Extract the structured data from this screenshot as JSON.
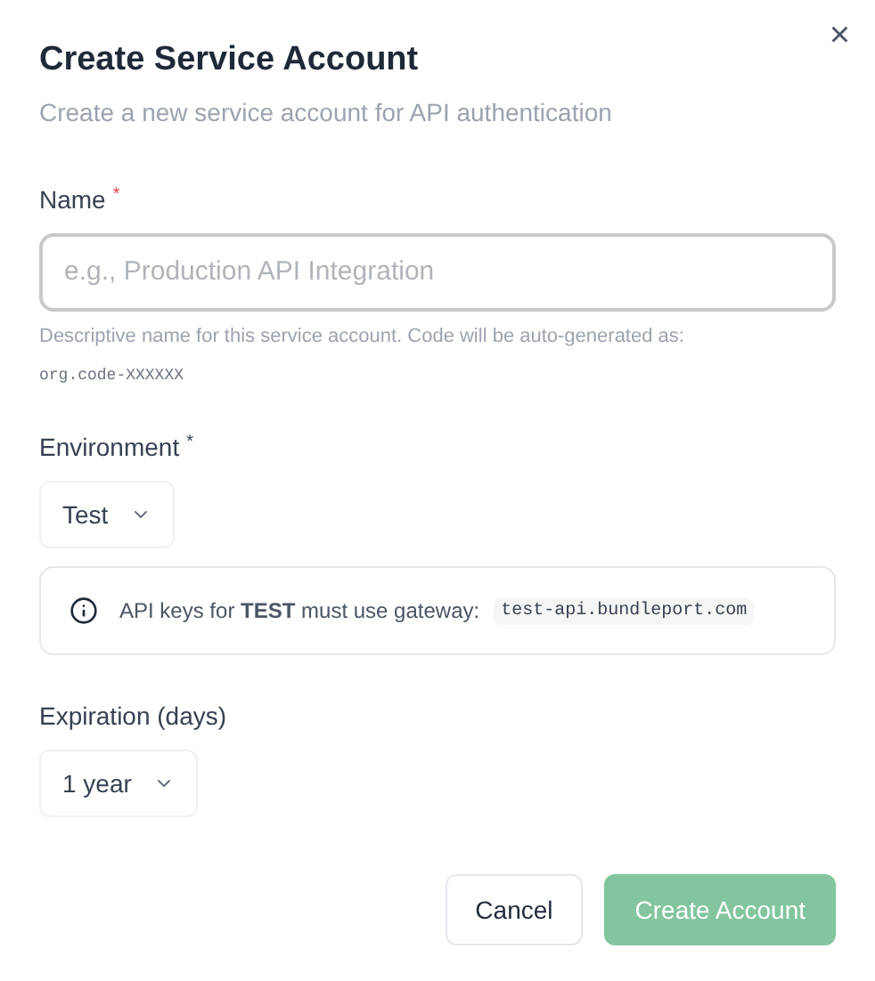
{
  "dialog": {
    "title": "Create Service Account",
    "subtitle": "Create a new service account for API authentication",
    "close": "×"
  },
  "name_field": {
    "label": "Name",
    "required_mark": "*",
    "color": "#ef4444",
    "placeholder": "e.g., Production API Integration",
    "help": "Descriptive name for this service account. Code will be auto-generated as:",
    "help_code": "org.code-XXXXXX"
  },
  "environment": {
    "label": "Environment",
    "required_mark": "*",
    "color": "#374151",
    "value": "Test",
    "info": "API keys for **TEST** must use gateway:",
    "info_code": "test-api.bundleport.com"
  },
  "expiration": {
    "label": "Expiration (days)",
    "value": "1 year"
  },
  "buttons": [
    {
      "label": "Cancel",
      "kind": "secondary",
      "disabled": false
    },
    {
      "label": "Create Account",
      "kind": "primary",
      "disabled": true
    }
  ]
}
